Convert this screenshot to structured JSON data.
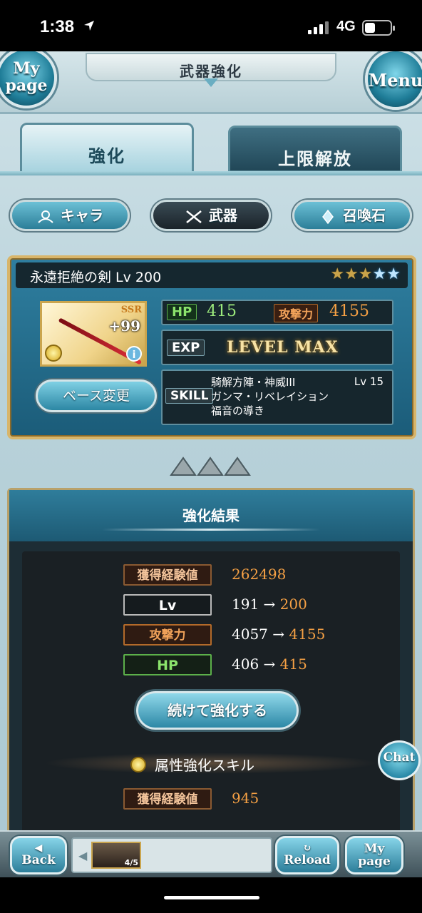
{
  "status_bar": {
    "time": "1:38",
    "network": "4G"
  },
  "header": {
    "title": "武器強化",
    "mypage_label": "My page",
    "menu_label": "Menu"
  },
  "tabs": [
    {
      "label": "強化",
      "active": true
    },
    {
      "label": "上限解放",
      "active": false
    }
  ],
  "categories": [
    {
      "label": "キャラ",
      "icon": "character-icon"
    },
    {
      "label": "武器",
      "icon": "weapon-icon",
      "active": true
    },
    {
      "label": "召喚石",
      "icon": "summon-stone-icon"
    }
  ],
  "weapon": {
    "name_level": "永遠拒絶の剣 Lv 200",
    "stars_total": 5,
    "stars_gold": 3,
    "rarity": "SSR",
    "plus": "+99",
    "hp_label": "HP",
    "hp": "415",
    "atk_label": "攻撃力",
    "atk": "4155",
    "exp_label": "EXP",
    "exp_value": "LEVEL MAX",
    "skill_label": "SKILL",
    "skills": [
      "騎解方陣・神威III",
      "ガンマ・リベレイション",
      "福音の導き"
    ],
    "skill_level": "Lv 15",
    "base_change_label": "ベース変更",
    "accent_color": "#d8b56a"
  },
  "result": {
    "title": "強化結果",
    "exp_label": "獲得経験値",
    "exp_value": "262498",
    "lv_label": "Lv",
    "lv_old": "191",
    "lv_new": "200",
    "atk_label": "攻撃力",
    "atk_old": "4057",
    "atk_new": "4155",
    "hp_label": "HP",
    "hp_old": "406",
    "hp_new": "415",
    "arrow": "→",
    "continue_label": "続けて強化する",
    "attr_skill_label": "属性強化スキル",
    "attr_exp_label": "獲得経験値",
    "attr_exp_value": "945"
  },
  "chat_label": "Chat",
  "bottom_bar": {
    "back_label": "Back",
    "reload_label": "Reload",
    "mypage_label": "My page",
    "quick_slot_count": "4/5"
  }
}
